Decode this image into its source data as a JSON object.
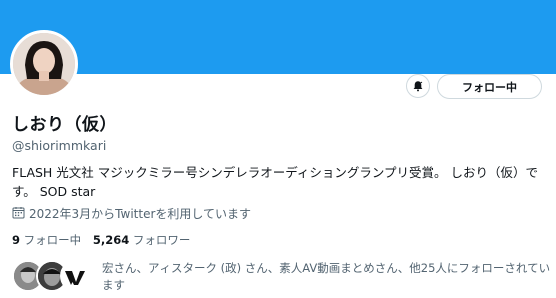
{
  "profile": {
    "name": "しおり（仮）",
    "handle": "@shiorimmkari",
    "bio": "FLASH 光文社 マジックミラー号シンデレラオーディショングランプリ受賞。 しおり（仮）です。 SOD star",
    "joined": "2022年3月からTwitterを利用しています"
  },
  "actions": {
    "follow_label": "フォロー中"
  },
  "stats": {
    "following_count": "9",
    "following_label": "フォロー中",
    "followers_count": "5,264",
    "followers_label": "フォロワー"
  },
  "followers_you_know": {
    "text": "宏さん、アィスターク (政) さん、素人AV動画まとめさん、他25人にフォローされています"
  },
  "colors": {
    "banner": "#1d9bf0",
    "secondary_text": "#536471"
  },
  "icons": [
    "bell-icon",
    "calendar-icon"
  ]
}
